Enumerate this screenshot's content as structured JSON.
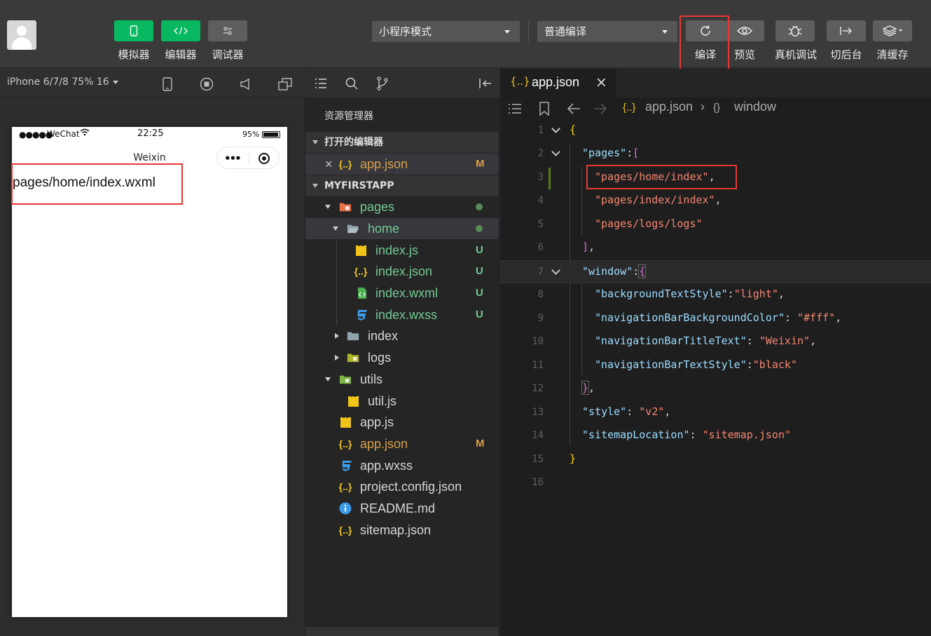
{
  "toolbar": {
    "left_buttons": [
      {
        "label": "模拟器",
        "icon": "phone-icon"
      },
      {
        "label": "编辑器",
        "icon": "code-icon"
      },
      {
        "label": "调试器",
        "icon": "sliders-icon"
      }
    ],
    "mode_select": "小程序模式",
    "compile_select": "普通编译",
    "right_buttons": [
      {
        "label": "编译",
        "icon": "refresh-icon"
      },
      {
        "label": "预览",
        "icon": "eye-icon"
      },
      {
        "label": "真机调试",
        "icon": "bug-icon"
      },
      {
        "label": "切后台",
        "icon": "switch-icon"
      },
      {
        "label": "清缓存",
        "icon": "layers-icon"
      }
    ]
  },
  "simulator": {
    "device": "iPhone 6/7/8 75% 16",
    "status": {
      "signal": "●●●●●",
      "carrier": "WeChat",
      "time": "22:25",
      "battery": "95%"
    },
    "nav_title": "Weixin",
    "capsule_more": "•••",
    "page_text": "pages/home/index.wxml"
  },
  "explorer": {
    "title": "资源管理器",
    "open_editors": "打开的编辑器",
    "open_file": {
      "name": "app.json",
      "status": "M"
    },
    "project": "MYFIRSTAPP",
    "tree": [
      {
        "name": "pages",
        "type": "folder",
        "level": 1,
        "status": "dot"
      },
      {
        "name": "home",
        "type": "folder",
        "level": 2,
        "status": "dot"
      },
      {
        "name": "index.js",
        "type": "js",
        "level": 3,
        "status": "U"
      },
      {
        "name": "index.json",
        "type": "json",
        "level": 3,
        "status": "U"
      },
      {
        "name": "index.wxml",
        "type": "wxml",
        "level": 3,
        "status": "U"
      },
      {
        "name": "index.wxss",
        "type": "wxss",
        "level": 3,
        "status": "U"
      },
      {
        "name": "index",
        "type": "folder",
        "level": 2,
        "status": ""
      },
      {
        "name": "logs",
        "type": "folder",
        "level": 2,
        "status": ""
      },
      {
        "name": "utils",
        "type": "folder",
        "level": 1,
        "status": ""
      },
      {
        "name": "util.js",
        "type": "js",
        "level": 2,
        "status": ""
      },
      {
        "name": "app.js",
        "type": "js",
        "level": 1,
        "status": ""
      },
      {
        "name": "app.json",
        "type": "json",
        "level": 1,
        "status": "M"
      },
      {
        "name": "app.wxss",
        "type": "wxss",
        "level": 1,
        "status": ""
      },
      {
        "name": "project.config.json",
        "type": "json",
        "level": 1,
        "status": ""
      },
      {
        "name": "README.md",
        "type": "info",
        "level": 1,
        "status": ""
      },
      {
        "name": "sitemap.json",
        "type": "json",
        "level": 1,
        "status": ""
      }
    ]
  },
  "editor": {
    "tab": {
      "icon": "{..}",
      "name": "app.json",
      "close": "×"
    },
    "breadcrumb": {
      "file": "app.json",
      "symbol": "window",
      "sep": "›",
      "symbol_icon": "{}"
    },
    "lines": [
      {
        "n": "1"
      },
      {
        "n": "2"
      },
      {
        "n": "3"
      },
      {
        "n": "4"
      },
      {
        "n": "5"
      },
      {
        "n": "6"
      },
      {
        "n": "7"
      },
      {
        "n": "8"
      },
      {
        "n": "9"
      },
      {
        "n": "10"
      },
      {
        "n": "11"
      },
      {
        "n": "12"
      },
      {
        "n": "13"
      },
      {
        "n": "14"
      },
      {
        "n": "15"
      },
      {
        "n": "16"
      }
    ],
    "tokens": {
      "pages_key": "\"pages\"",
      "home_index": "\"pages/home/index\"",
      "index_index": "\"pages/index/index\"",
      "logs_logs": "\"pages/logs/logs\"",
      "window_key": "\"window\"",
      "bts_key": "\"backgroundTextStyle\"",
      "bts_val": "\"light\"",
      "nbbc_key": "\"navigationBarBackgroundColor\"",
      "nbbc_val": "\"#fff\"",
      "nbtt_key": "\"navigationBarTitleText\"",
      "nbtt_val": "\"Weixin\"",
      "nbts_key": "\"navigationBarTextStyle\"",
      "nbts_val": "\"black\"",
      "style_key": "\"style\"",
      "style_val": "\"v2\"",
      "sitemap_key": "\"sitemapLocation\"",
      "sitemap_val": "\"sitemap.json\""
    }
  },
  "colors": {
    "accent_green": "#07b861",
    "highlight": "#e53935"
  }
}
